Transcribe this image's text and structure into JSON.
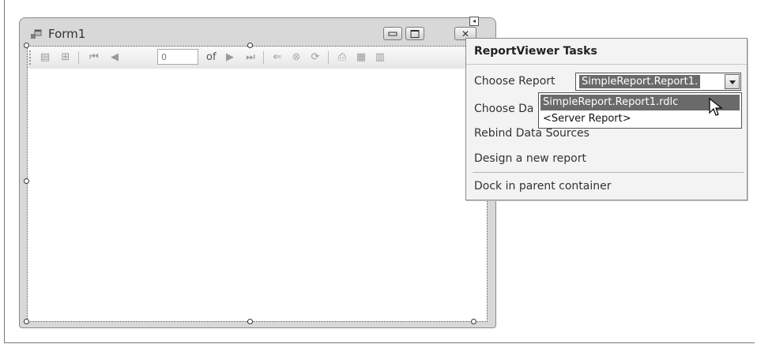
{
  "form": {
    "title": "Form1",
    "buttons": {
      "minimize": "minimize",
      "maximize": "maximize",
      "close": "close"
    }
  },
  "toolbar": {
    "page_value": "0",
    "of_label": "of",
    "icons": [
      "parameters-icon",
      "document-map-icon",
      "first-page-icon",
      "previous-page-icon",
      "next-page-icon",
      "last-page-icon",
      "back-icon",
      "stop-icon",
      "refresh-icon",
      "print-icon",
      "print-layout-icon",
      "page-setup-icon"
    ]
  },
  "tasks": {
    "header": "ReportViewer Tasks",
    "choose_report_label": "Choose Report",
    "choose_report_value": "SimpleReport.Report1.",
    "choose_data_label": "Choose Da",
    "rebind_label": "Rebind Data Sources",
    "design_label": "Design a new report",
    "dock_label": "Dock in parent container"
  },
  "dropdown": {
    "options": [
      "SimpleReport.Report1.rdlc",
      "<Server Report>"
    ],
    "selected_index": 0
  }
}
